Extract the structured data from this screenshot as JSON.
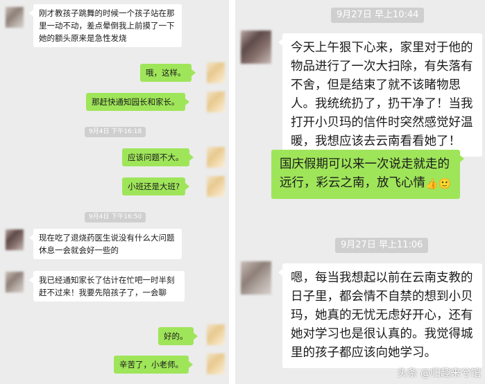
{
  "left_chat": {
    "messages": [
      {
        "id": "l1",
        "side": "left",
        "text": "刚才教孩子跳舞的时候一个孩子站在那里一动不动，差点晕倒我上前摸了一下她的额头原来是急性发烧"
      },
      {
        "id": "l2",
        "side": "right",
        "text": "哦，这样。"
      },
      {
        "id": "l3",
        "side": "right",
        "text": "那赶快通知园长和家长。"
      },
      {
        "id": "l4",
        "side": "right",
        "text": "应该问题不大。"
      },
      {
        "id": "l5",
        "side": "right",
        "text": "小班还是大班?"
      },
      {
        "id": "l6",
        "side": "left",
        "text": "现在吃了退烧药医生说没有什么大问题休息一会就会好一些的"
      },
      {
        "id": "l7",
        "side": "left",
        "text": "我已经通知家长了估计在忙吧一时半刻赶不过来！我要先陪孩子了，一会聊"
      },
      {
        "id": "l8",
        "side": "right",
        "text": "好的。"
      },
      {
        "id": "l9",
        "side": "right",
        "text": "辛苦了，小老师。"
      }
    ],
    "timestamps": [
      "9月4日 下午16:18",
      "9月4日 下午16:50"
    ]
  },
  "right_chat": {
    "timestamps": [
      "9月27日 早上10:44",
      "9月27日 早上11:06"
    ],
    "messages": [
      {
        "id": "r1",
        "side": "left",
        "text": "今天上午狠下心来，家里对于他的物品进行了一次大扫除，有失落有不舍，但是结束了就不该睹物思人。我统统扔了，扔干净了！当我打开小贝玛的信件时突然感觉好温暖，我想应该去云南看看她了！"
      },
      {
        "id": "r2",
        "side": "right",
        "text": "国庆假期可以来一次说走就走的远行，彩云之南，放飞心情"
      },
      {
        "id": "r3",
        "side": "left",
        "text": "嗯，每当我想起以前在云南支教的日子里，都会情不自禁的想到小贝玛，她真的无忧无虑好开心，还有她对学习也是很认真的。我觉得城里的孩子都应该向她学习。"
      }
    ],
    "emoji": [
      "thumbs-up",
      "smiley"
    ]
  },
  "watermark": "头条 @归趣来兮馆",
  "colors": {
    "bg": "#ececec",
    "green_bubble": "#9fe55a",
    "white_bubble": "#ffffff",
    "time_badge": "#cfcfcf"
  }
}
